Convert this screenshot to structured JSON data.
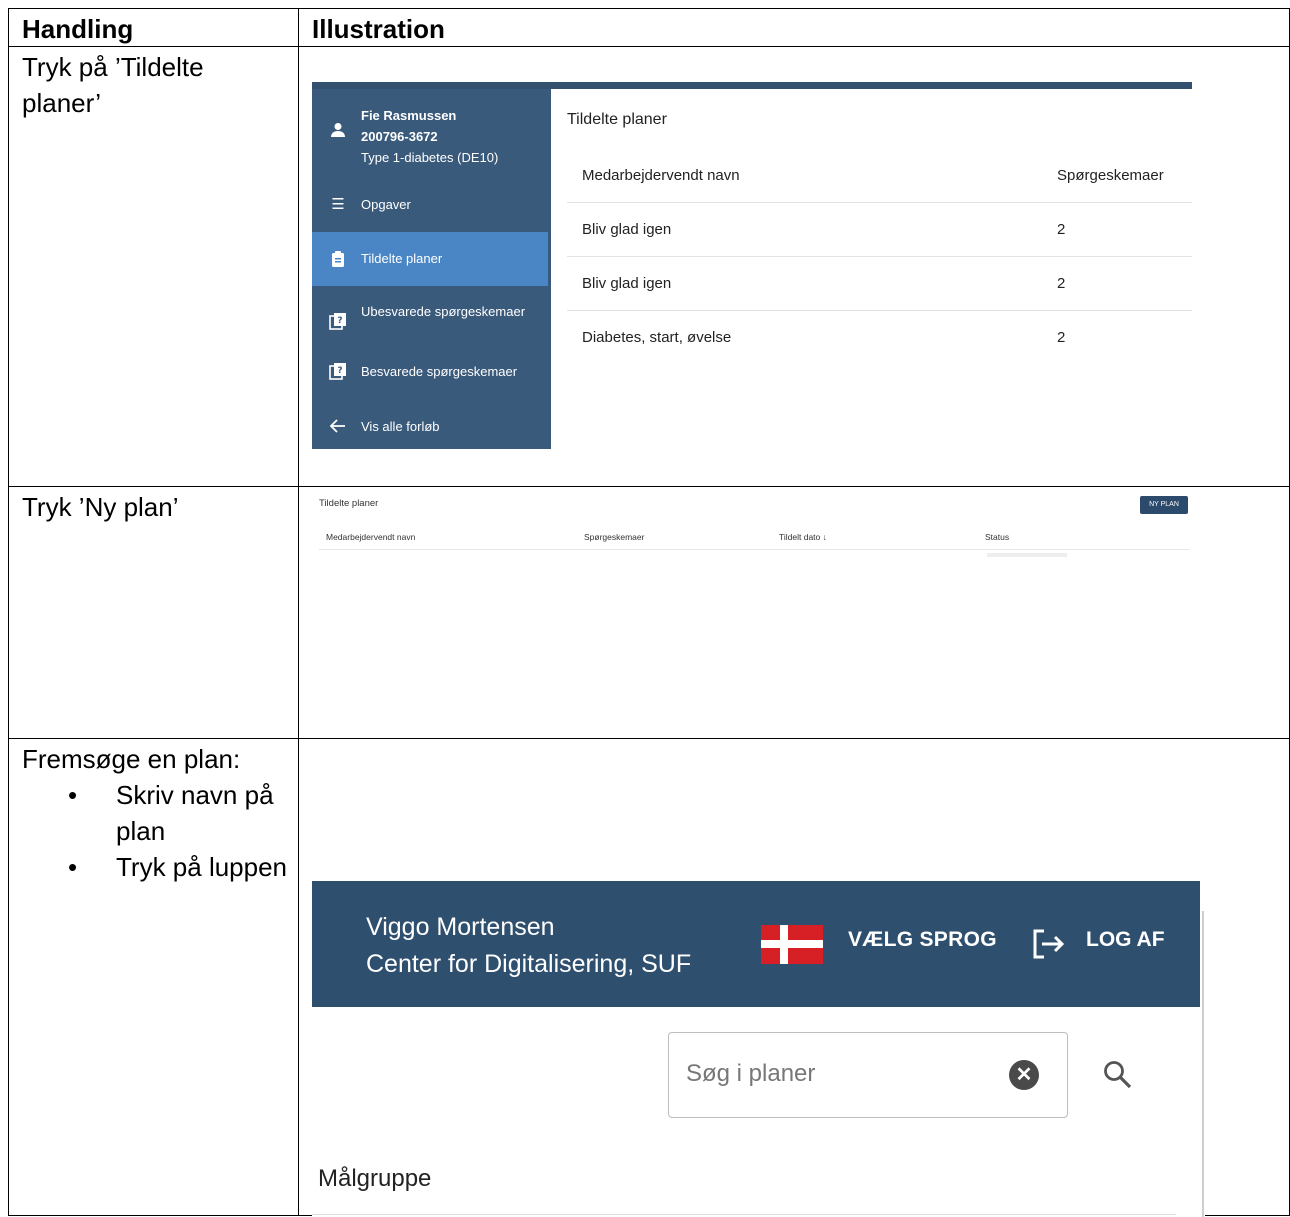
{
  "table": {
    "headers": [
      "Handling",
      "Illustration"
    ],
    "row1_action": "Tryk på ’Tildelte planer’",
    "row2_action": "Tryk ’Ny plan’",
    "row3_action_title": "Fremsøge en plan:",
    "row3_bullets": [
      "Skriv navn på plan",
      "Tryk på luppen"
    ]
  },
  "ill1": {
    "patient_name": "Fie Rasmussen",
    "patient_id": "200796-3672",
    "patient_diag": "Type 1-diabetes (DE10)",
    "nav": [
      {
        "label": "Opgaver",
        "icon": "list-icon"
      },
      {
        "label": "Tildelte planer",
        "icon": "clipboard-icon"
      },
      {
        "label": "Ubesvarede spørgeskemaer",
        "icon": "questionnaire-icon"
      },
      {
        "label": "Besvarede spørgeskemaer",
        "icon": "questionnaire-icon"
      },
      {
        "label": "Vis alle forløb",
        "icon": "arrow-left-icon"
      }
    ],
    "main_title": "Tildelte planer",
    "col_name": "Medarbejdervendt navn",
    "col_forms": "Spørgeskemaer",
    "rows": [
      {
        "name": "Bliv glad igen",
        "forms": "2"
      },
      {
        "name": "Bliv glad igen",
        "forms": "2"
      },
      {
        "name": "Diabetes, start, øvelse",
        "forms": "2"
      }
    ],
    "colors": {
      "sidebar": "#3a5a7c",
      "active": "#4a86c5"
    }
  },
  "ill2": {
    "title": "Tildelte planer",
    "button": "NY PLAN",
    "columns": [
      "Medarbejdervendt navn",
      "Spørgeskemaer",
      "Tildelt dato ↓",
      "Status"
    ]
  },
  "ill3": {
    "user_name": "Viggo Mortensen",
    "org": "Center for Digitalisering, SUF",
    "lang_button": "VÆLG SPROG",
    "logout_button": "LOG AF",
    "search_placeholder": "Søg i planer",
    "section_label": "Målgruppe",
    "colors": {
      "header": "#2f4f6f",
      "flag_red": "#d71f26"
    }
  }
}
